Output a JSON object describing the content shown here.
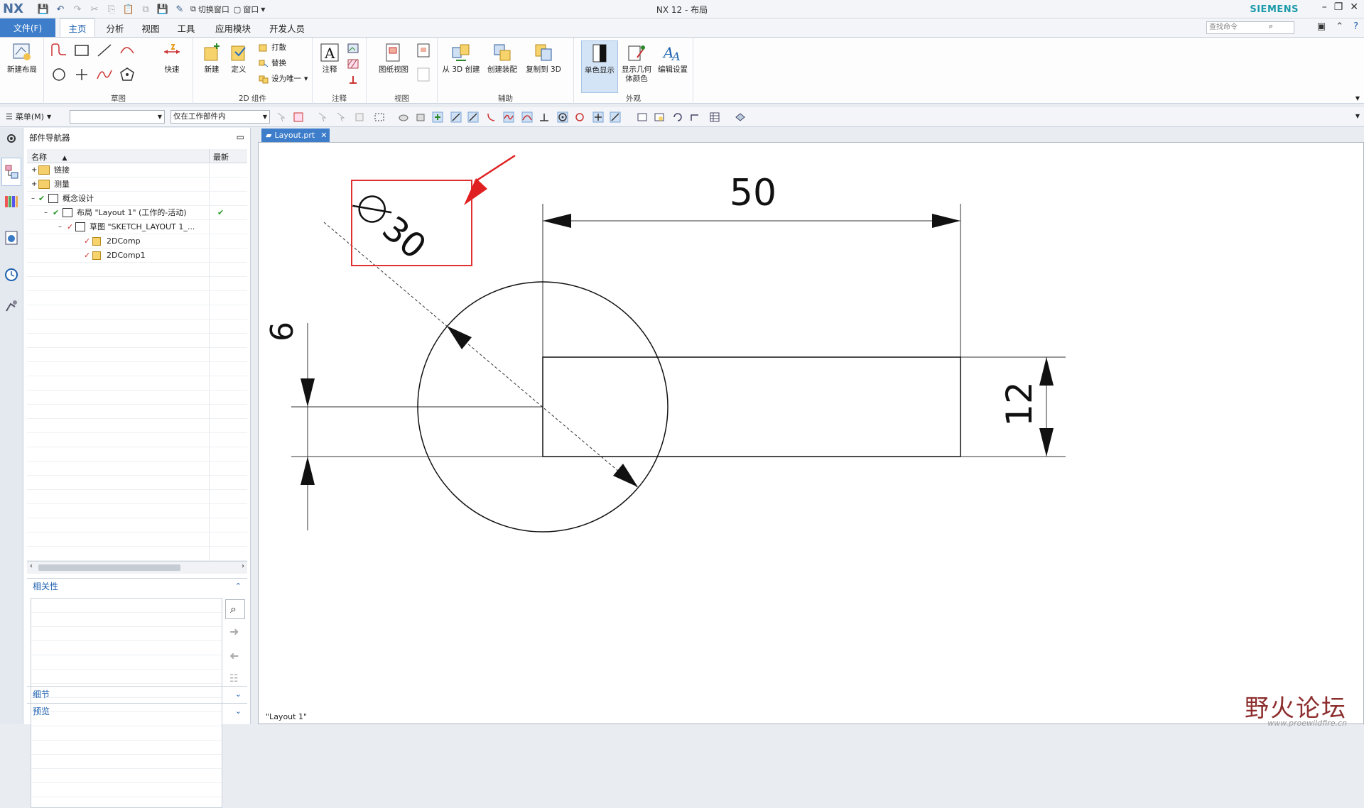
{
  "window": {
    "logo": "NX",
    "title": "NX 12 - 布局",
    "brand": "SIEMENS",
    "quick_access": {
      "switch_window": "切换窗口",
      "window": "窗口"
    }
  },
  "menubar": {
    "file": "文件(F)",
    "tabs": [
      "主页",
      "分析",
      "视图",
      "工具",
      "应用模块",
      "开发人员"
    ],
    "active_tab": "主页",
    "search_placeholder": "查找命令"
  },
  "ribbon": {
    "new_layout": "新建布局",
    "sketch_group": "草图",
    "quick": "快速",
    "comp_new": "新建",
    "comp_define": "定义",
    "comp_break": "打散",
    "comp_replace": "替换",
    "comp_unique": "设为唯一",
    "comp_group": "2D 组件",
    "note": "注释",
    "annotation_group": "注释",
    "drawing_view": "图纸视图",
    "view_group": "视图",
    "from_3d": "从 3D 创建",
    "create_assembly": "创建装配",
    "copy_to_3d": "复制到 3D",
    "aux_group": "辅助",
    "mono_display": "单色显示",
    "show_geom_color": "显示几何体颜色",
    "edit_settings": "编辑设置",
    "appearance_group": "外观"
  },
  "toolbar2": {
    "menu": "菜单(M)",
    "filter_value": "",
    "scope_value": "仅在工作部件内"
  },
  "navigator": {
    "title": "部件导航器",
    "columns": {
      "name": "名称",
      "latest": "最新"
    },
    "rows": [
      {
        "label": "链接",
        "latest": ""
      },
      {
        "label": "测量",
        "latest": ""
      },
      {
        "label": "概念设计",
        "latest": ""
      },
      {
        "label": "布局 \"Layout 1\" (工作的-活动)",
        "latest": "✔"
      },
      {
        "label": "草图 \"SKETCH_LAYOUT 1_...",
        "latest": ""
      },
      {
        "label": "2DComp",
        "latest": ""
      },
      {
        "label": "2DComp1",
        "latest": ""
      }
    ],
    "dependencies": "相关性",
    "details": "细节",
    "preview": "预览"
  },
  "graphics": {
    "doc_tab": "Layout.prt",
    "status_text": "\"Layout 1\"",
    "dims": {
      "diameter": "30",
      "width": "50",
      "vertical_left": "6",
      "vertical_right": "12"
    }
  },
  "watermark": {
    "text": "野火论坛",
    "url": "www.proewildfire.cn"
  },
  "colors": {
    "accent": "#3d7dca",
    "highlight_box": "#e03030",
    "arrow": "#e02020",
    "brand": "#1b9aaa"
  }
}
